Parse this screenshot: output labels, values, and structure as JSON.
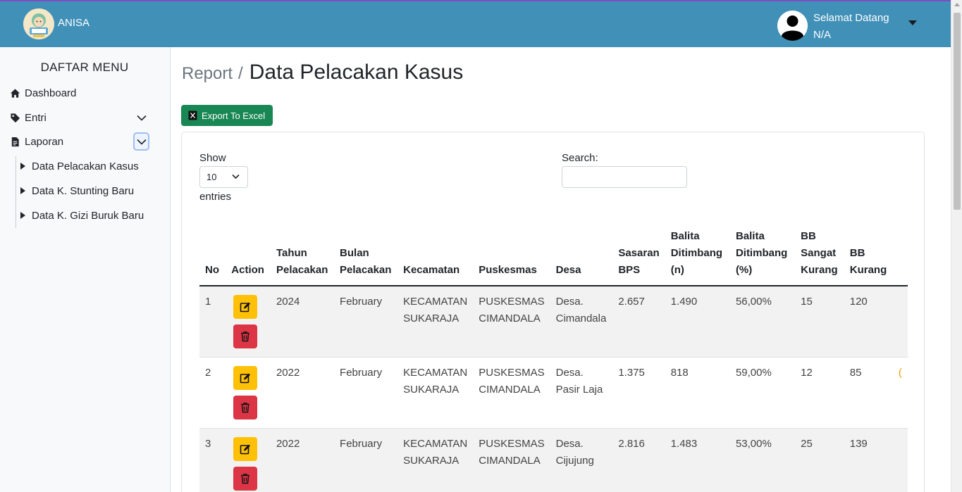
{
  "header": {
    "brand": "ANISA",
    "logo_icon": "anisa-logo",
    "greeting": "Selamat Datang",
    "user_name": "N/A",
    "accent_color": "#4190b8"
  },
  "sidebar": {
    "title": "DAFTAR MENU",
    "items": [
      {
        "label": "Dashboard",
        "icon": "home-icon"
      },
      {
        "label": "Entri",
        "icon": "tag-icon",
        "expandable": true
      },
      {
        "label": "Laporan",
        "icon": "file-icon",
        "expandable": true,
        "expanded": true
      }
    ],
    "subitems": [
      {
        "label": "Data Pelacakan Kasus"
      },
      {
        "label": "Data K. Stunting Baru"
      },
      {
        "label": "Data K. Gizi Buruk Baru"
      }
    ]
  },
  "page": {
    "breadcrumb_parent": "Report",
    "breadcrumb_sep": "/",
    "title": "Data Pelacakan Kasus",
    "export_label": "Export To Excel"
  },
  "datatable": {
    "show_label": "Show",
    "page_size": "10",
    "entries_label": "entries",
    "search_label": "Search:",
    "search_value": "",
    "columns": [
      [
        "No"
      ],
      [
        "Action"
      ],
      [
        "Tahun",
        "Pelacakan"
      ],
      [
        "Bulan",
        "Pelacakan"
      ],
      [
        "Kecamatan"
      ],
      [
        "Puskesmas"
      ],
      [
        "Desa"
      ],
      [
        "Sasaran",
        "BPS"
      ],
      [
        "Balita",
        "Ditimbang",
        "(n)"
      ],
      [
        "Balita",
        "Ditimbang",
        "(%)"
      ],
      [
        "BB",
        "Sangat",
        "Kurang"
      ],
      [
        "BB",
        "Kurang"
      ]
    ],
    "rows": [
      {
        "no": "1",
        "tahun": "2024",
        "bulan": "February",
        "kecamatan": [
          "KECAMATAN",
          "SUKARAJA"
        ],
        "puskesmas": [
          "PUSKESMAS",
          "CIMANDALA"
        ],
        "desa": [
          "Desa.",
          "Cimandala"
        ],
        "sasaran": "2.657",
        "ditimbang_n": "1.490",
        "ditimbang_pct": "56,00%",
        "bb_sangat_kurang": "15",
        "bb_kurang": "120",
        "next_col": ""
      },
      {
        "no": "2",
        "tahun": "2022",
        "bulan": "February",
        "kecamatan": [
          "KECAMATAN",
          "SUKARAJA"
        ],
        "puskesmas": [
          "PUSKESMAS",
          "CIMANDALA"
        ],
        "desa": [
          "Desa.",
          "Pasir Laja"
        ],
        "sasaran": "1.375",
        "ditimbang_n": "818",
        "ditimbang_pct": "59,00%",
        "bb_sangat_kurang": "12",
        "bb_kurang": "85",
        "next_col": "("
      },
      {
        "no": "3",
        "tahun": "2022",
        "bulan": "February",
        "kecamatan": [
          "KECAMATAN",
          "SUKARAJA"
        ],
        "puskesmas": [
          "PUSKESMAS",
          "CIMANDALA"
        ],
        "desa": [
          "Desa.",
          "Cijujung"
        ],
        "sasaran": "2.816",
        "ditimbang_n": "1.483",
        "ditimbang_pct": "53,00%",
        "bb_sangat_kurang": "25",
        "bb_kurang": "139",
        "next_col": ""
      }
    ],
    "actions": {
      "edit_icon": "pencil-square-icon",
      "delete_icon": "trash-icon",
      "edit_color": "#ffc107",
      "delete_color": "#dc3545"
    }
  }
}
